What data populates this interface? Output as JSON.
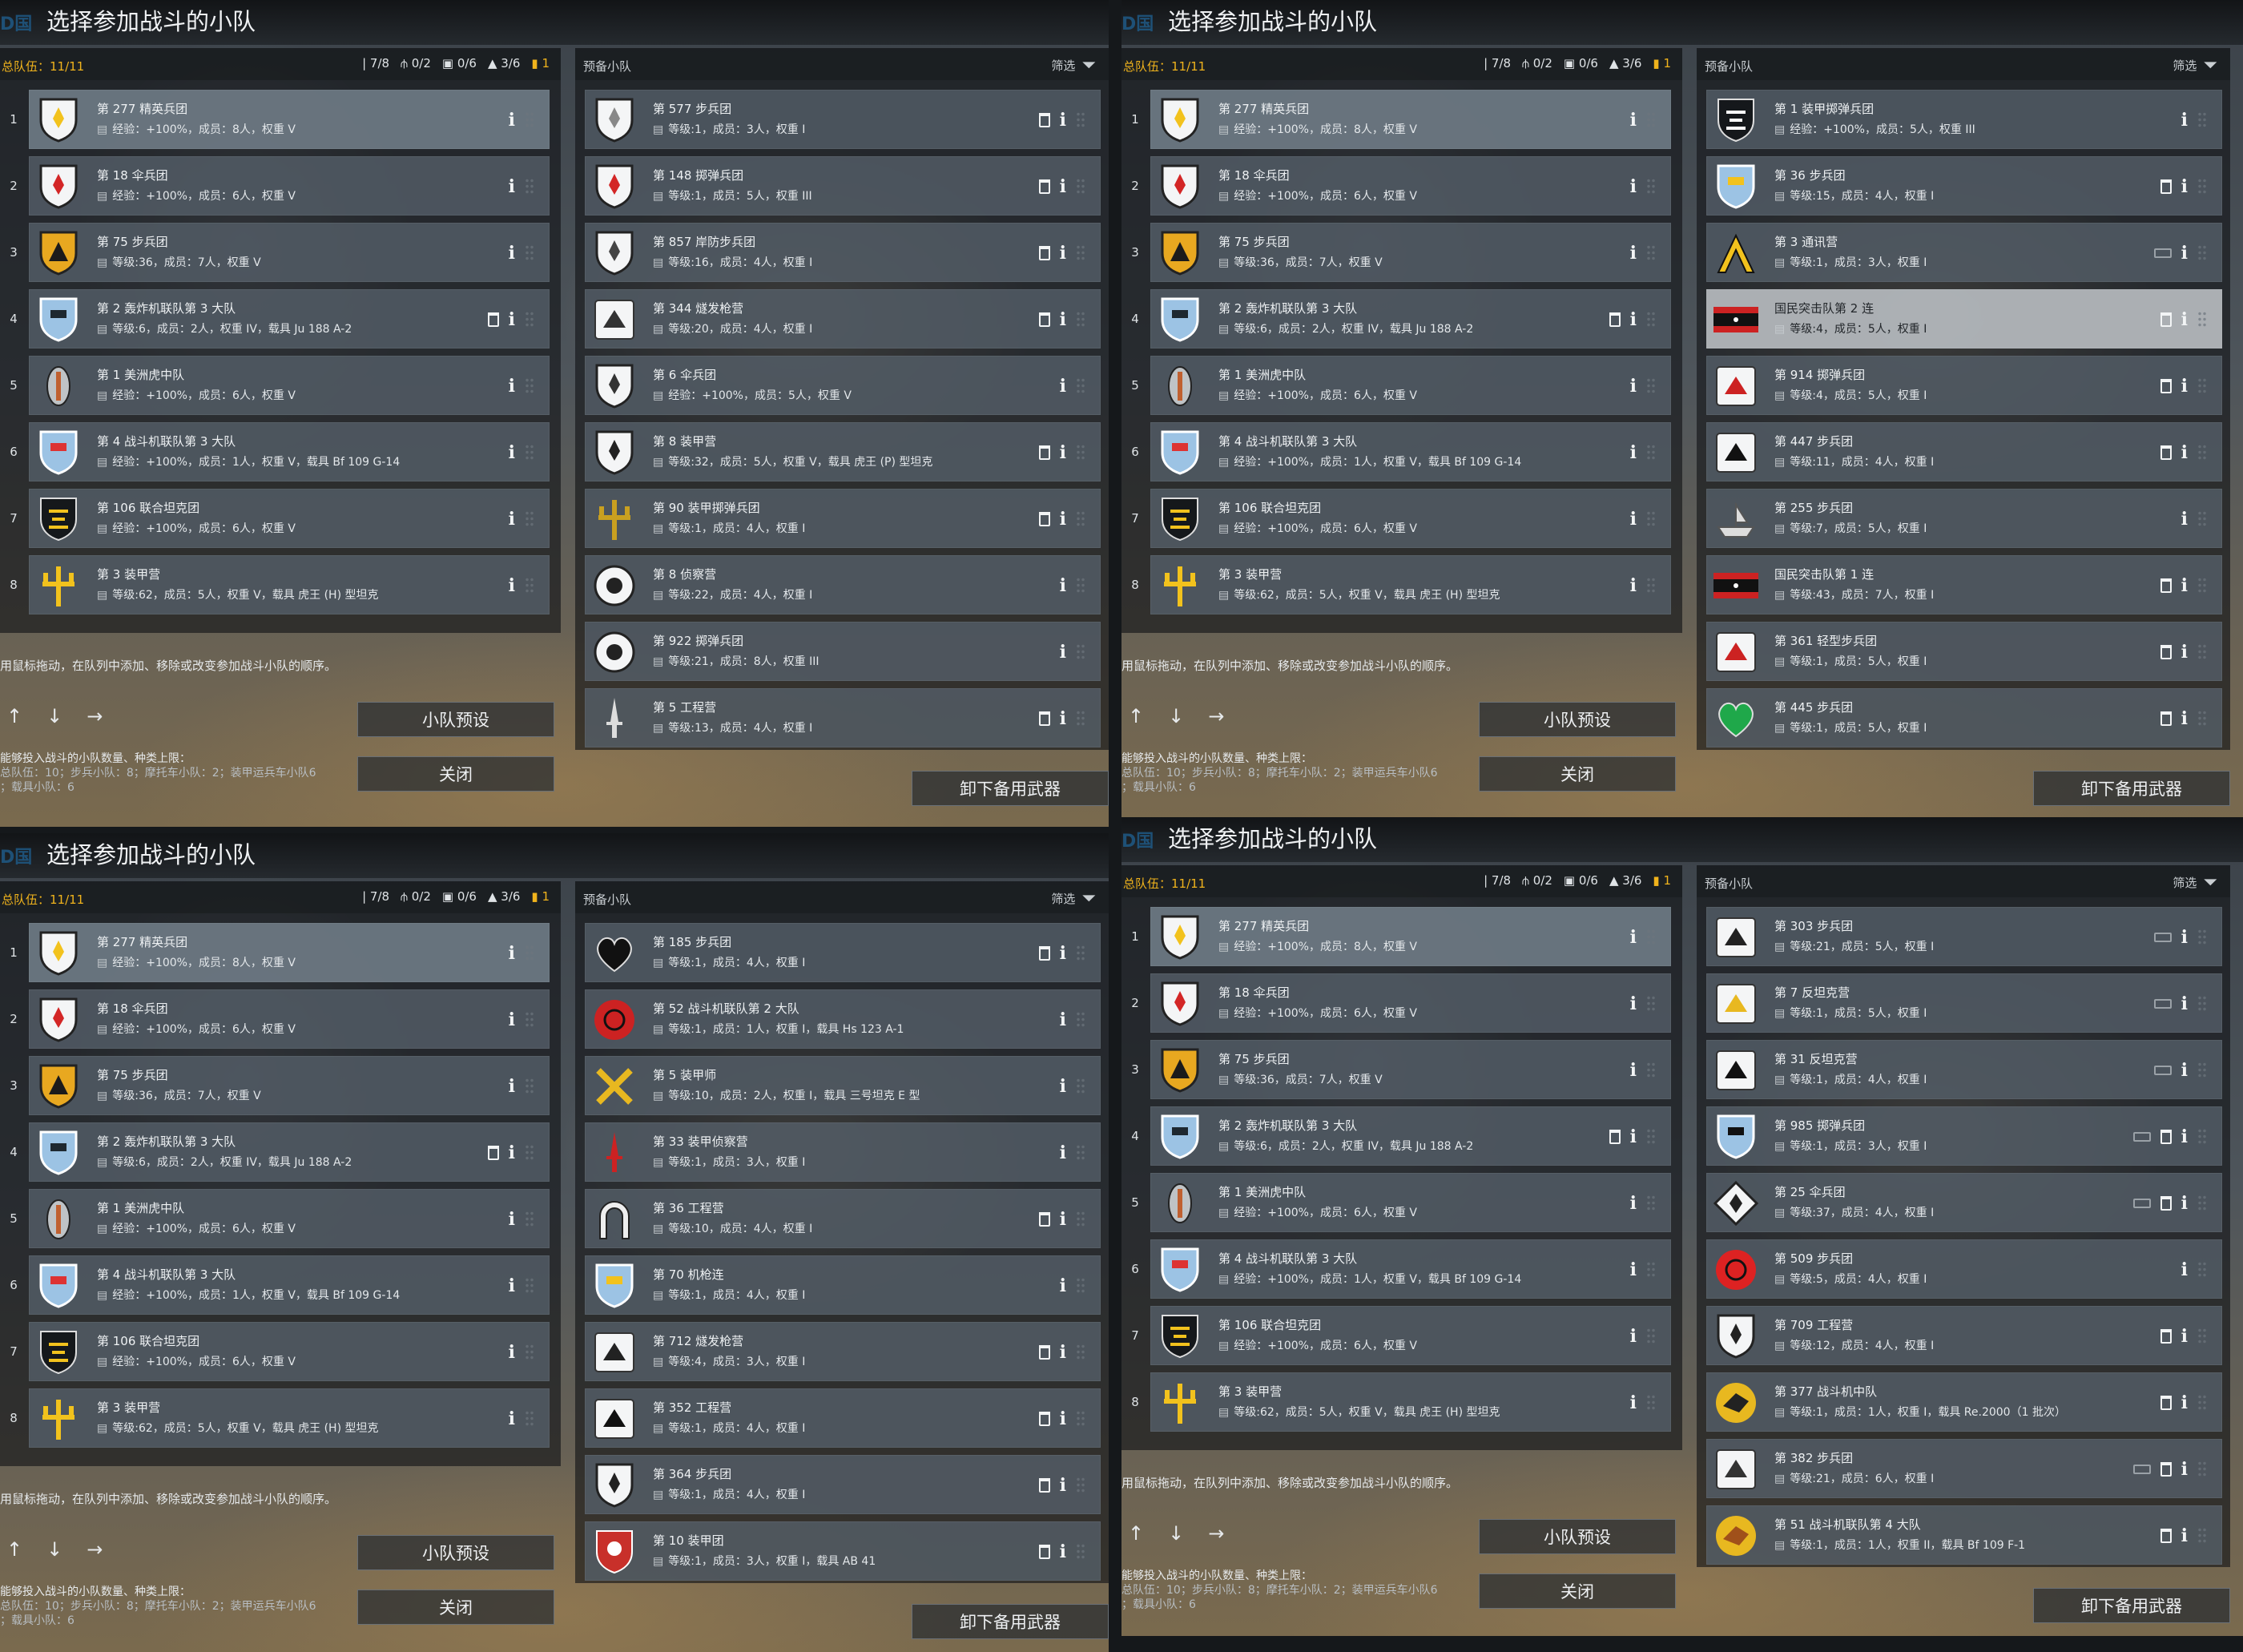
{
  "common": {
    "title": "选择参加战斗的小队",
    "tag": "D国",
    "total": "总队伍：11/11",
    "caps": [
      "7/8",
      "0/2",
      "0/6",
      "3/6",
      "1"
    ],
    "reserve": "预备小队",
    "filter": "筛选",
    "hint": "用鼠标拖动，在队列中添加、移除或改变参加战斗小队的顺序。",
    "limits_title": "能够投入战斗的小队数量、种类上限：",
    "limits_1": "总队伍：10；步兵小队：8；摩托车小队：2；装甲运兵车小队6",
    "limits_2": "；载具小队：6",
    "preset": "小队预设",
    "close": "关闭",
    "unload": "卸下备用武器"
  },
  "colors": {
    "accent": "#f0b31c",
    "row": "#56606a",
    "highlight": "#b2b6ba"
  },
  "active": [
    {
      "n": "1",
      "name": "第 277 精英兵团",
      "stat": "经验：+100%，成员：8人，权重 V",
      "icon": "shield-white",
      "c": "#f2c21d"
    },
    {
      "n": "2",
      "name": "第 18 伞兵团",
      "stat": "经验：+100%，成员：6人，权重 V",
      "icon": "shield-white",
      "c": "#d32626"
    },
    {
      "n": "3",
      "name": "第 75 步兵团",
      "stat": "等级:36，成员：7人，权重 V",
      "icon": "shield-gold",
      "c": "#1b1b1b"
    },
    {
      "n": "4",
      "name": "第 2 轰炸机联队第 3 大队",
      "stat": "等级:6，成员：2人，权重 IV，载具 Ju 188 A-2",
      "icon": "shield-blue",
      "c": "#1e2830",
      "trash": true
    },
    {
      "n": "5",
      "name": "第 1 美洲虎中队",
      "stat": "经验：+100%，成员：6人，权重 V",
      "icon": "oval-grey",
      "c": "#c06030"
    },
    {
      "n": "6",
      "name": "第 4 战斗机联队第 3 大队",
      "stat": "经验：+100%，成员：1人，权重 V，载具 Bf 109 G-14",
      "icon": "shield-blue",
      "c": "#d33"
    },
    {
      "n": "7",
      "name": "第 106 联合坦克团",
      "stat": "经验：+100%，成员：6人，权重 V",
      "icon": "shield-black",
      "c": "#f2c21d"
    },
    {
      "n": "8",
      "name": "第 3 装甲营",
      "stat": "等级:62，成员：5人，权重 V，载具 虎王 (H) 型坦克",
      "icon": "trident",
      "c": "#f2c21d"
    }
  ],
  "quads": [
    {
      "reserve": [
        {
          "name": "第 577 步兵团",
          "stat": "等级:1，成员：3人，权重 I",
          "icon": "shield-white",
          "c": "#888",
          "trash": true
        },
        {
          "name": "第 148 掷弹兵团",
          "stat": "等级:1，成员：5人，权重 III",
          "icon": "shield-white",
          "c": "#d32626",
          "trash": true
        },
        {
          "name": "第 857 岸防步兵团",
          "stat": "等级:16，成员：4人，权重 I",
          "icon": "shield-white",
          "c": "#444",
          "trash": true
        },
        {
          "name": "第 344 燧发枪营",
          "stat": "等级:20，成员：4人，权重 I",
          "icon": "square-white",
          "c": "#333",
          "trash": true
        },
        {
          "name": "第 6 伞兵团",
          "stat": "经验：+100%，成员：5人，权重 V",
          "icon": "shield-white",
          "c": "#333"
        },
        {
          "name": "第 8 装甲营",
          "stat": "等级:32，成员：5人，权重 V，载具 虎王 (P) 型坦克",
          "icon": "shield-white",
          "c": "#222",
          "trash": true
        },
        {
          "name": "第 90 装甲掷弹兵团",
          "stat": "等级:1，成员：4人，权重 I",
          "icon": "trident",
          "c": "#c9a020",
          "trash": true
        },
        {
          "name": "第 8 侦察营",
          "stat": "等级:22，成员：4人，权重 I",
          "icon": "circle-white",
          "c": "#222"
        },
        {
          "name": "第 922 掷弹兵团",
          "stat": "等级:21，成员：8人，权重 III",
          "icon": "circle-white",
          "c": "#222"
        },
        {
          "name": "第 5 工程营",
          "stat": "等级:13，成员：4人，权重 I",
          "icon": "dagger",
          "c": "#ddd",
          "trash": true
        }
      ]
    },
    {
      "reserve": [
        {
          "name": "第 1 装甲掷弹兵团",
          "stat": "经验：+100%，成员：5人，权重 III",
          "icon": "shield-black",
          "c": "#fff"
        },
        {
          "name": "第 36 步兵团",
          "stat": "等级:15，成员：4人，权重 I",
          "icon": "shield-blue",
          "c": "#f2c21d",
          "trash": true
        },
        {
          "name": "第 3 通讯营",
          "stat": "等级:1，成员：3人，权重 I",
          "icon": "chevron",
          "c": "#f2c21d",
          "tank": true
        },
        {
          "name": "国民突击队第 2 连",
          "stat": "等级:4，成员：5人，权重 I",
          "icon": "flag",
          "c": "#c22",
          "trash": true,
          "sel": true
        },
        {
          "name": "第 914 掷弹兵团",
          "stat": "等级:4，成员：5人，权重 I",
          "icon": "square-white",
          "c": "#c22",
          "trash": true
        },
        {
          "name": "第 447 步兵团",
          "stat": "等级:11，成员：4人，权重 I",
          "icon": "square-white",
          "c": "#111",
          "trash": true
        },
        {
          "name": "第 255 步兵团",
          "stat": "等级:7，成员：5人，权重 I",
          "icon": "ship",
          "c": "#ddd"
        },
        {
          "name": "国民突击队第 1 连",
          "stat": "等级:43，成员：7人，权重 I",
          "icon": "flag",
          "c": "#c22",
          "trash": true
        },
        {
          "name": "第 361 轻型步兵团",
          "stat": "等级:1，成员：5人，权重 I",
          "icon": "square-white",
          "c": "#c22",
          "trash": true
        },
        {
          "name": "第 445 步兵团",
          "stat": "等级:1，成员：5人，权重 I",
          "icon": "heart",
          "c": "#1fa84a",
          "trash": true
        }
      ]
    },
    {
      "reserve": [
        {
          "name": "第 185 步兵团",
          "stat": "等级:1，成员：4人，权重 I",
          "icon": "heart",
          "c": "#111",
          "trash": true
        },
        {
          "name": "第 52 战斗机联队第 2 大队",
          "stat": "等级:1，成员：1人，权重 I，载具 Hs 123 A-1",
          "icon": "circle-red",
          "c": "#c22"
        },
        {
          "name": "第 5 装甲师",
          "stat": "等级:10，成员：2人，权重 I，载具 三号坦克 E 型",
          "icon": "cross",
          "c": "#e8b820"
        },
        {
          "name": "第 33 装甲侦察营",
          "stat": "等级:1，成员：3人，权重 I",
          "icon": "dagger",
          "c": "#c22"
        },
        {
          "name": "第 36 工程营",
          "stat": "等级:10，成员：4人，权重 I",
          "icon": "arch",
          "c": "#eee",
          "trash": true
        },
        {
          "name": "第 70 机枪连",
          "stat": "等级:1，成员：4人，权重 I",
          "icon": "shield-blue",
          "c": "#f2c21d"
        },
        {
          "name": "第 712 燧发枪营",
          "stat": "等级:4，成员：3人，权重 I",
          "icon": "square-white",
          "c": "#222",
          "trash": true
        },
        {
          "name": "第 352 工程营",
          "stat": "等级:1，成员：4人，权重 I",
          "icon": "square-white",
          "c": "#111",
          "trash": true
        },
        {
          "name": "第 364 步兵团",
          "stat": "等级:1，成员：4人，权重 I",
          "icon": "shield-white",
          "c": "#222",
          "trash": true
        },
        {
          "name": "第 10 装甲团",
          "stat": "等级:1，成员：3人，权重 I，载具 AB 41",
          "icon": "shield-red",
          "c": "#fff",
          "trash": true
        }
      ]
    },
    {
      "reserve": [
        {
          "name": "第 303 步兵团",
          "stat": "等级:21，成员：5人，权重 I",
          "icon": "square-white",
          "c": "#222",
          "tank": true
        },
        {
          "name": "第 7 反坦克营",
          "stat": "等级:1，成员：5人，权重 I",
          "icon": "square-white",
          "c": "#e8b820",
          "tank": true
        },
        {
          "name": "第 31 反坦克营",
          "stat": "等级:1，成员：4人，权重 I",
          "icon": "square-white",
          "c": "#111",
          "tank": true
        },
        {
          "name": "第 985 掷弹兵团",
          "stat": "等级:1，成员：3人，权重 I",
          "icon": "shield-blue",
          "c": "#111",
          "trash": true,
          "tank": true
        },
        {
          "name": "第 25 伞兵团",
          "stat": "等级:37，成员：4人，权重 I",
          "icon": "diamond",
          "c": "#222",
          "trash": true,
          "tank": true
        },
        {
          "name": "第 509 步兵团",
          "stat": "等级:5，成员：4人，权重 I",
          "icon": "circle-red",
          "c": "#d22"
        },
        {
          "name": "第 709 工程营",
          "stat": "等级:12，成员：4人，权重 I",
          "icon": "shield-white",
          "c": "#222",
          "trash": true
        },
        {
          "name": "第 377 战斗机中队",
          "stat": "等级:1，成员：1人，权重 I，载具 Re.2000（1 批次）",
          "icon": "circle-gold",
          "c": "#222",
          "trash": true
        },
        {
          "name": "第 382 步兵团",
          "stat": "等级:21，成员：6人，权重 I",
          "icon": "square-white",
          "c": "#333",
          "trash": true,
          "tank": true
        },
        {
          "name": "第 51 战斗机联队第 4 大队",
          "stat": "等级:1，成员：1人，权重 II，载具 Bf 109 F-1",
          "icon": "circle-gold",
          "c": "#a0501a",
          "trash": true
        }
      ]
    }
  ]
}
